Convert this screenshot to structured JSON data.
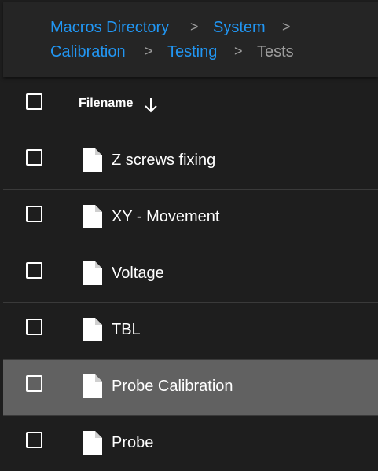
{
  "breadcrumb": {
    "items": [
      {
        "label": "Macros Directory"
      },
      {
        "label": "System"
      },
      {
        "label": "Calibration"
      },
      {
        "label": "Testing"
      },
      {
        "label": "Tests"
      }
    ],
    "separator": ">"
  },
  "table": {
    "header": {
      "column_label": "Filename",
      "sort_icon": "arrow-down-icon"
    },
    "rows": [
      {
        "name": "Z screws fixing",
        "icon": "file-icon"
      },
      {
        "name": "XY - Movement",
        "icon": "file-icon"
      },
      {
        "name": "Voltage",
        "icon": "file-icon"
      },
      {
        "name": "TBL",
        "icon": "file-icon"
      },
      {
        "name": "Probe Calibration",
        "icon": "file-icon",
        "highlighted": true
      },
      {
        "name": "Probe",
        "icon": "file-icon"
      }
    ]
  },
  "colors": {
    "background": "#1e1e1e",
    "breadcrumb_bg": "#252525",
    "link": "#2196f3",
    "current": "#9e9e9e",
    "highlight_row": "#616161",
    "text": "#ffffff"
  }
}
